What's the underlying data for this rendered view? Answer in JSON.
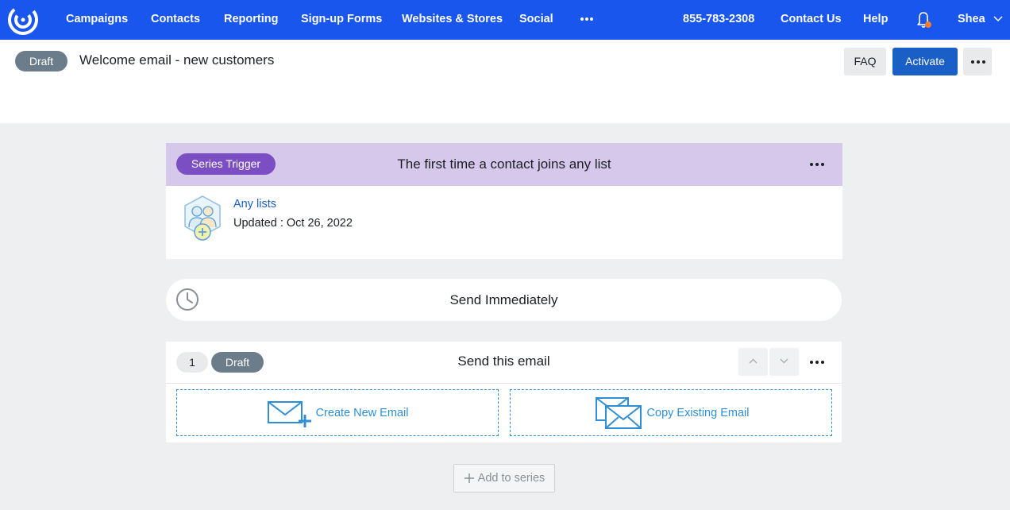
{
  "topnav": {
    "items": [
      "Campaigns",
      "Contacts",
      "Reporting",
      "Sign-up Forms",
      "Websites & Stores",
      "Social"
    ],
    "phone": "855-783-2308",
    "contact_us": "Contact Us",
    "help": "Help",
    "user": "Shea",
    "brand_color": "#1856ed"
  },
  "header": {
    "status": "Draft",
    "title": "Welcome email - new customers",
    "faq": "FAQ",
    "activate": "Activate"
  },
  "trigger": {
    "badge": "Series Trigger",
    "title": "The first time a contact joins any list",
    "list_link": "Any lists",
    "updated": "Updated : Oct 26, 2022"
  },
  "timing": {
    "label": "Send Immediately"
  },
  "email_step": {
    "number": "1",
    "status": "Draft",
    "title": "Send this email",
    "create_label": "Create New Email",
    "copy_label": "Copy Existing Email"
  },
  "add_to_series": "Add to series"
}
